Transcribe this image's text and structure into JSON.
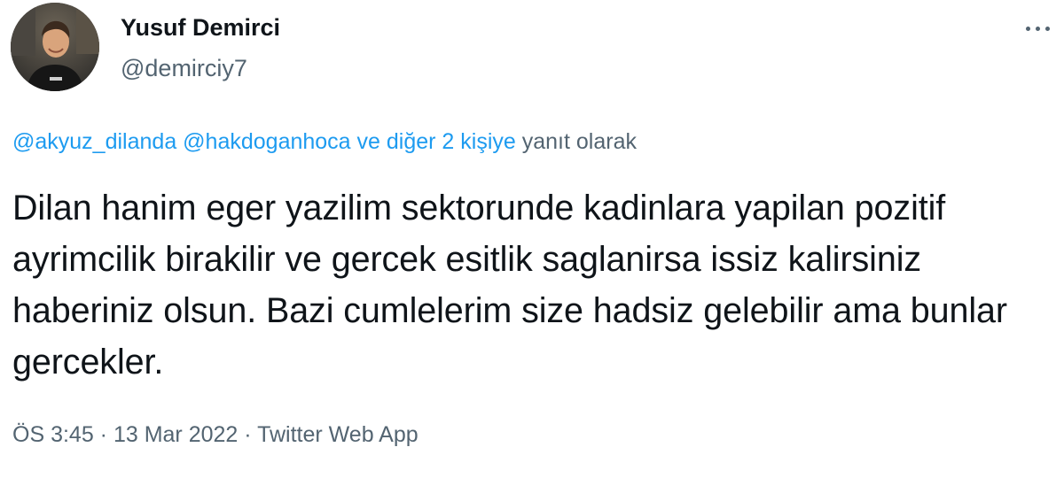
{
  "user": {
    "display_name": "Yusuf Demirci",
    "handle": "@demirciy7"
  },
  "more_icon": "more-horizontal-icon",
  "reply": {
    "mention1": "@akyuz_dilanda",
    "mention2": "@hakdoganhoca",
    "others": "ve diğer 2 kişiye",
    "suffix": "yanıt olarak"
  },
  "tweet": {
    "text": "Dilan hanim eger yazilim sektorunde kadinlara yapilan pozitif ayrimcilik birakilir ve gercek esitlik saglanirsa issiz kalirsiniz haberiniz olsun. Bazi cumlelerim size hadsiz gelebilir ama bunlar gercekler.",
    "time": "ÖS 3:45",
    "separator": " · ",
    "date": "13 Mar 2022",
    "source": "Twitter Web App"
  },
  "colors": {
    "link": "#1d9bf0",
    "secondary": "#536471",
    "text": "#0f1419"
  }
}
